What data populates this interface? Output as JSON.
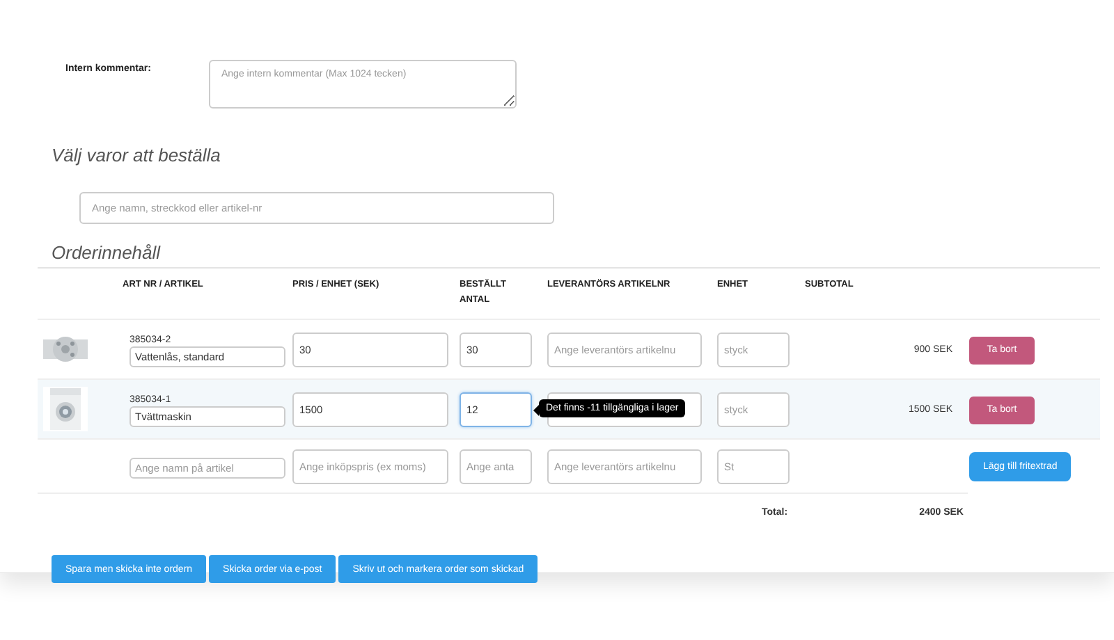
{
  "comment": {
    "label": "Intern kommentar:",
    "placeholder": "Ange intern kommentar (Max 1024 tecken)"
  },
  "select_heading": "Välj varor att beställa",
  "search": {
    "placeholder": "Ange namn, streckkod eller artikel-nr"
  },
  "order_heading": "Orderinnehåll",
  "table": {
    "columns": [
      "ART NR / ARTIKEL",
      "PRIS / ENHET (SEK)",
      "BESTÄLLT ANTAL",
      "LEVERANTÖRS ARTIKELNR",
      "ENHET",
      "SUBTOTAL"
    ],
    "rows": [
      {
        "kind": "item",
        "highlighted": false,
        "art_nr": "385034-2",
        "name": "Vattenlås, standard",
        "price": "30",
        "quantity": "30",
        "quantity_focused": false,
        "supplier_placeholder": "Ange leverantörs artikelnu",
        "unit_placeholder": "styck",
        "subtotal": "900 SEK",
        "button": "Ta bort"
      },
      {
        "kind": "item",
        "highlighted": true,
        "art_nr": "385034-1",
        "name": "Tvättmaskin",
        "price": "1500",
        "quantity": "12",
        "quantity_focused": true,
        "tooltip": "Det finns -11 tillgängliga i lager",
        "unit_placeholder": "styck",
        "subtotal": "1500 SEK",
        "button": "Ta bort"
      },
      {
        "kind": "new",
        "name_placeholder": "Ange namn på artikel",
        "price_placeholder": "Ange inköpspris (ex moms)",
        "quantity_placeholder": "Ange anta",
        "supplier_placeholder": "Ange leverantörs artikelnu",
        "unit_placeholder": "St",
        "button": "Lägg till fritextrad"
      }
    ],
    "total_label": "Total:",
    "total": "2400 SEK"
  },
  "buttons": [
    "Spara men skicka inte ordern",
    "Skicka order via e-post",
    "Skriv ut och markera order som skickad"
  ]
}
